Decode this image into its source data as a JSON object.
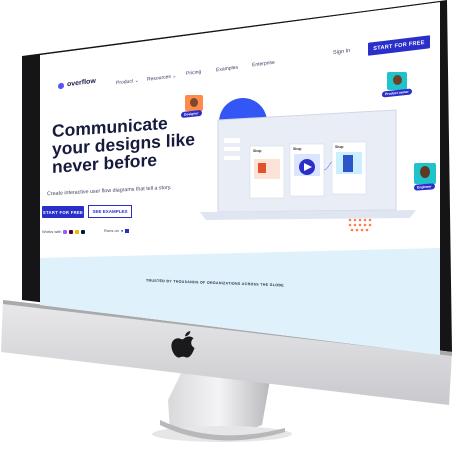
{
  "brand": {
    "name": "overflow"
  },
  "nav": {
    "product": "Product ⌄",
    "resources": "Resources ⌄",
    "pricing": "Pricing",
    "examples": "Examples",
    "enterprise": "Enterprise",
    "signin": "Sign In",
    "cta": "START FOR FREE"
  },
  "hero": {
    "line1": "Communicate",
    "line2": "your designs like",
    "line3": "never before",
    "subtitle": "Create interactive user flow diagrams that tell a story.",
    "primary_button": "START FOR FREE",
    "secondary_button": "SEE EXAMPLES",
    "works_with": "Works with",
    "runs_on": "Runs on"
  },
  "tags": {
    "designer": "Designer",
    "product_owner": "Product owner",
    "engineer": "Engineer"
  },
  "mock_screens": {
    "a": "Shop",
    "b": "Shop",
    "c": "Shop"
  },
  "trusted": {
    "text": "TRUSTED BY THOUSANDS OF ORGANIZATIONS ACROSS THE GLOBE"
  },
  "colors": {
    "accent": "#2b2fc9",
    "light_band": "#dff1fb",
    "heading": "#161a3d"
  }
}
